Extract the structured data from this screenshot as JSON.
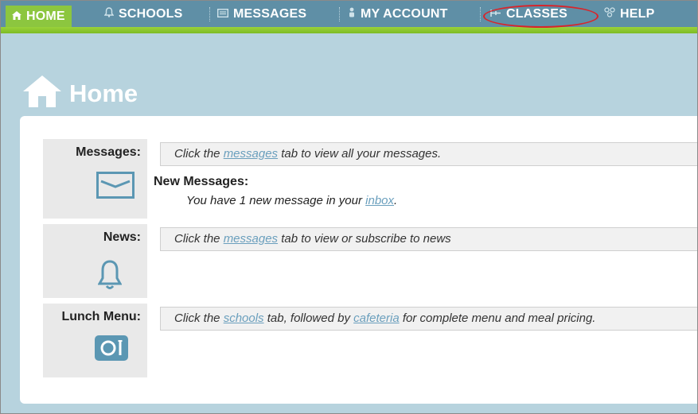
{
  "nav": {
    "tabs": [
      {
        "label": "HOME",
        "icon": "home-icon",
        "active": true
      },
      {
        "label": "SCHOOLS",
        "icon": "bell-icon"
      },
      {
        "label": "MESSAGES",
        "icon": "envelope-icon"
      },
      {
        "label": "MY ACCOUNT",
        "icon": "person-icon"
      },
      {
        "label": "CLASSES",
        "icon": "classes-icon"
      },
      {
        "label": "HELP",
        "icon": "help-icon"
      }
    ]
  },
  "page": {
    "title": "Home"
  },
  "sections": {
    "messages": {
      "label": "Messages:",
      "info_prefix": "Click the ",
      "info_link": "messages",
      "info_suffix": " tab to view all your messages.",
      "new_title": "New Messages:",
      "new_prefix": "You have 1 new message in your ",
      "new_link": "inbox",
      "new_suffix": "."
    },
    "news": {
      "label": "News:",
      "info_prefix": "Click the ",
      "info_link": "messages",
      "info_suffix": " tab to view or subscribe to news"
    },
    "lunch": {
      "label": "Lunch Menu:",
      "info_prefix": "Click the ",
      "info_link1": "schools",
      "info_middle": " tab, followed by ",
      "info_link2": "cafeteria",
      "info_suffix": " for complete menu and meal pricing."
    }
  },
  "colors": {
    "nav_bg": "#5f8fa6",
    "nav_accent": "#8cc63f",
    "page_bg": "#b7d3de",
    "icon_blue": "#5b97b3",
    "link": "#6a9fbd",
    "annotation": "#d8242a"
  }
}
